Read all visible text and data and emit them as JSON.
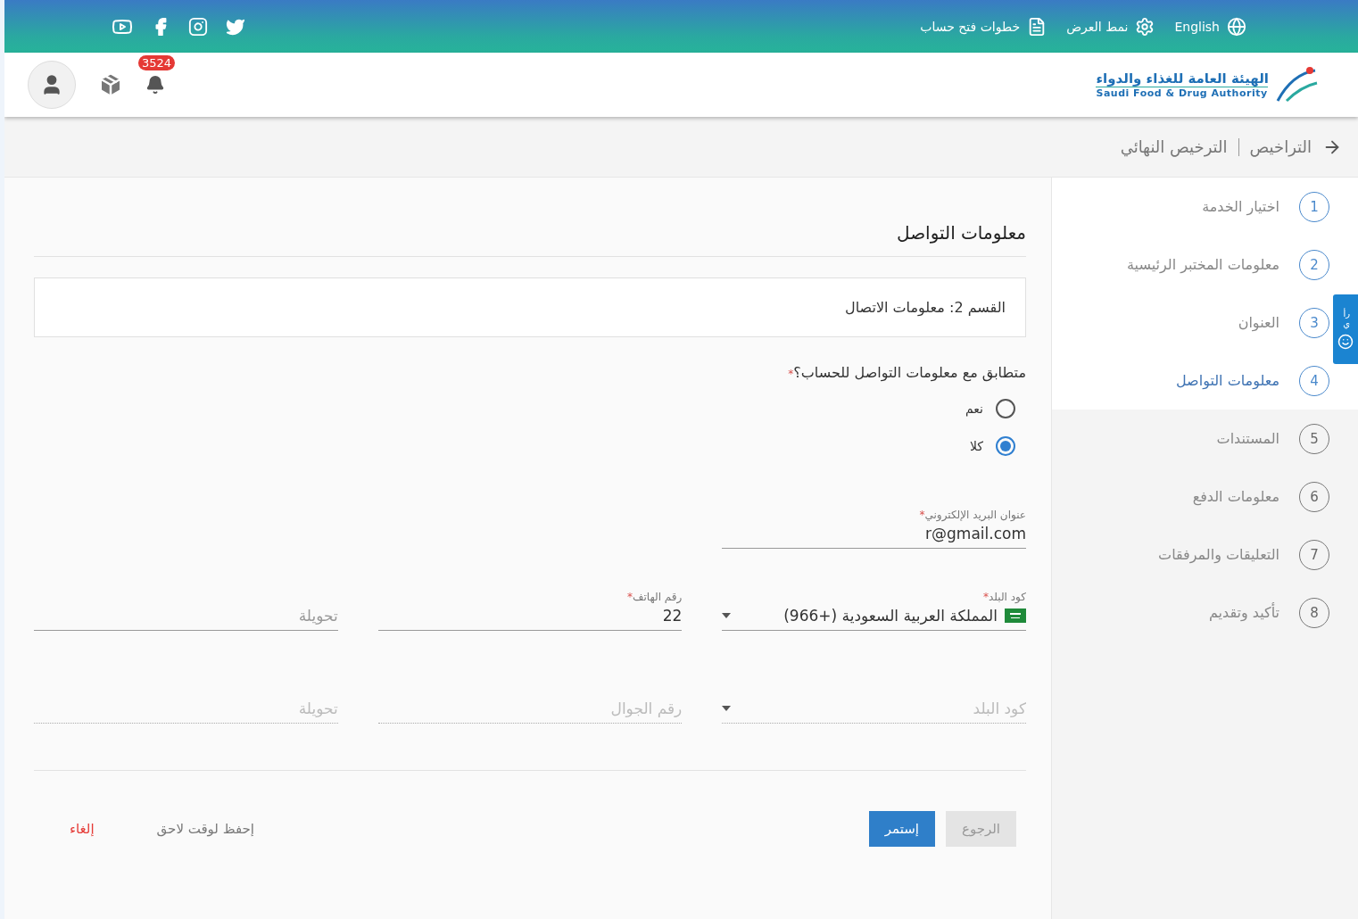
{
  "top_bar": {
    "language": "English",
    "display_mode": "نمط العرض",
    "signup_steps": "خطوات فتح حساب"
  },
  "header": {
    "logo_arabic": "الهيئة العامة للغذاء والدواء",
    "logo_english": "Saudi Food & Drug Authority",
    "notification_count": "3524"
  },
  "breadcrumb": {
    "items": [
      "التراخيص",
      "الترخيص النهائي"
    ]
  },
  "steps": [
    {
      "number": "1",
      "label": "اختيار الخدمة",
      "enabled": true
    },
    {
      "number": "2",
      "label": "معلومات المختبر الرئيسية",
      "enabled": true
    },
    {
      "number": "3",
      "label": "العنوان",
      "enabled": true
    },
    {
      "number": "4",
      "label": "معلومات التواصل",
      "enabled": true
    },
    {
      "number": "5",
      "label": "المستندات",
      "enabled": false
    },
    {
      "number": "6",
      "label": "معلومات الدفع",
      "enabled": false
    },
    {
      "number": "7",
      "label": "التعليقات والمرفقات",
      "enabled": false
    },
    {
      "number": "8",
      "label": "تأكيد وتقديم",
      "enabled": false
    }
  ],
  "feedback_tab": {
    "label": "رأي"
  },
  "form": {
    "title": "معلومات التواصل",
    "section": "القسم 2: معلومات الاتصال",
    "question": {
      "label": "متطابق مع معلومات التواصل للحساب؟",
      "required_mark": "*",
      "options": [
        {
          "label": "نعم",
          "selected": false
        },
        {
          "label": "كلا",
          "selected": true
        }
      ]
    },
    "email": {
      "label": "عنوان البريد الإلكتروني",
      "required_mark": "*",
      "value": "r@gmail.com"
    },
    "rows": [
      {
        "disabled": false,
        "fields": [
          {
            "kind": "select",
            "label": "كود البلد",
            "required_mark": "*",
            "value": "المملكة العربية السعودية (+966)"
          },
          {
            "kind": "input",
            "label": "رقم الهاتف",
            "required_mark": "*",
            "value": "22"
          },
          {
            "kind": "input",
            "placeholder": "تحويلة"
          }
        ]
      },
      {
        "disabled": true,
        "fields": [
          {
            "kind": "select",
            "placeholder": "كود البلد"
          },
          {
            "kind": "input",
            "placeholder": "رقم الجوال"
          },
          {
            "kind": "input",
            "placeholder": "تحويلة"
          }
        ]
      }
    ],
    "buttons": {
      "back": "الرجوع",
      "continue": "إستمر",
      "save_later": "إحفظ لوقت لاحق",
      "cancel": "إلغاء"
    }
  }
}
